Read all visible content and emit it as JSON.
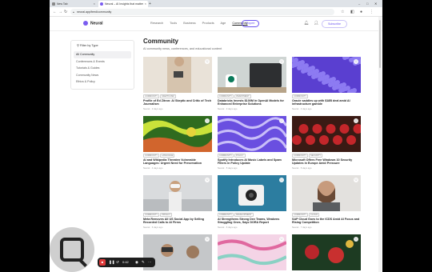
{
  "browser": {
    "tabs": [
      {
        "label": "New Tab"
      },
      {
        "label": "Neural – AI Insights that matter"
      }
    ],
    "new_tab": "+",
    "url": "neural.app/feed/community",
    "nav": {
      "back": "←",
      "forward": "→",
      "reload": "↻"
    },
    "window": {
      "minimize": "–",
      "maximize": "□",
      "close": "✕"
    }
  },
  "site": {
    "logo": "Neural",
    "nav": [
      "Research",
      "Tools",
      "Business",
      "Products",
      "Age",
      "Community"
    ],
    "active_nav": "Community",
    "expert_button": "Expert",
    "subscribe_button": "Subscribe"
  },
  "sidebar": {
    "title": "Filter by Type",
    "items": [
      {
        "label": "All Community",
        "active": true
      },
      {
        "label": "Conferences & Events",
        "active": false
      },
      {
        "label": "Tutorials & Guides",
        "active": false
      },
      {
        "label": "Community News",
        "active": false
      },
      {
        "label": "Ethics & Policy",
        "active": false
      }
    ]
  },
  "main": {
    "title": "Community",
    "description": "AI community news, conferences, and educational content"
  },
  "cards": [
    {
      "title": "Profile of Ed Zitron: AI Skeptic and Critic of Tech Journalism",
      "tags": [
        "COMMUNITY",
        "SKEPTICISM"
      ],
      "meta": "Neural · 3 days ago",
      "art": "woman"
    },
    {
      "title": "Databricks Invests $100M in OpenAI Models for Enhanced Enterprise Solutions",
      "tags": [
        "COMMUNITY",
        "INVESTMENT"
      ],
      "meta": "Neural · 3 days ago",
      "art": "laptop"
    },
    {
      "title": "Oracle saddles up with $18B deal amid AI infrastructure gamble",
      "tags": [
        "COMMUNITY"
      ],
      "meta": "Neural · 4 days ago",
      "art": "purple-dots"
    },
    {
      "title": "AI and Wikipedia Threaten Vulnerable Languages: Urgent Need for Preservation",
      "tags": [
        "COMMUNITY",
        "LANGUAGE"
      ],
      "meta": "Neural · 4 days ago",
      "art": "green-swirl"
    },
    {
      "title": "Spotify Introduces AI Music Labels and Spam Filters in Policy Update",
      "tags": [
        "COMMUNITY",
        "POLICY"
      ],
      "meta": "Neural · 5 days ago",
      "art": "purple-wave"
    },
    {
      "title": "Microsoft Offers Free Windows 10 Security Updates in Europe Amid Pressure",
      "tags": [
        "COMMUNITY",
        "SECURITY"
      ],
      "meta": "Neural · 5 days ago",
      "art": "dolls"
    },
    {
      "title": "Meta Removes All US Social App by Selling Recorded Calls to AI Firms",
      "tags": [
        "COMMUNITY",
        "PRIVACY"
      ],
      "meta": "Neural · 6 days ago",
      "art": "vr"
    },
    {
      "title": "AI Strengthens Strong Dev Teams, Weakens Struggling Ones, Says DORA Report",
      "tags": [
        "COMMUNITY",
        "DEVELOPMENT"
      ],
      "meta": "Neural · 6 days ago",
      "art": "camera"
    },
    {
      "title": "SAP Cloud Goes to the ICDS Amid AI Focus and Rising Competition",
      "tags": [
        "COMMUNITY",
        "CLOUD"
      ],
      "meta": "Neural · 7 days ago",
      "art": "man"
    },
    {
      "title": "",
      "tags": [],
      "meta": "",
      "art": "vr2"
    },
    {
      "title": "",
      "tags": [],
      "meta": "",
      "art": "pink-swirl"
    },
    {
      "title": "",
      "tags": [],
      "meta": "",
      "art": "ornaments"
    }
  ],
  "recorder": {
    "stop": "■",
    "pause": "❚❚",
    "restart": "↺",
    "time": "0:42",
    "more": "⋯"
  }
}
